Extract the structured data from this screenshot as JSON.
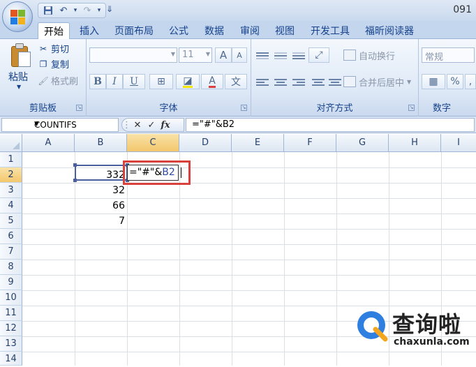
{
  "window": {
    "doc_title": "091"
  },
  "quick_access": {
    "save_icon": "save-icon",
    "undo_icon": "undo-icon",
    "redo_icon": "redo-icon",
    "more_symbol": "⇓"
  },
  "tabs": [
    {
      "label": "开始",
      "active": true
    },
    {
      "label": "插入"
    },
    {
      "label": "页面布局"
    },
    {
      "label": "公式"
    },
    {
      "label": "数据"
    },
    {
      "label": "审阅"
    },
    {
      "label": "视图"
    },
    {
      "label": "开发工具"
    },
    {
      "label": "福昕阅读器"
    }
  ],
  "ribbon": {
    "clipboard": {
      "label": "剪贴板",
      "paste": "粘贴",
      "cut": "剪切",
      "copy": "复制",
      "format_painter": "格式刷"
    },
    "font": {
      "label": "字体",
      "font_size": "11",
      "bold": "B",
      "italic": "I",
      "underline": "U",
      "grow": "A",
      "shrink": "A",
      "font_color": "A"
    },
    "alignment": {
      "label": "对齐方式",
      "wrap_text": "自动换行",
      "merge_center": "合并后居中"
    },
    "number": {
      "label": "数字",
      "format": "常规",
      "percent": "%",
      "comma": ","
    }
  },
  "formula_bar": {
    "name_box": "COUNTIFS",
    "cancel": "✕",
    "enter": "✓",
    "fx": "fx",
    "content": "=\"#\"&B2"
  },
  "grid": {
    "columns": [
      "A",
      "B",
      "C",
      "D",
      "E",
      "F",
      "G",
      "H",
      "I"
    ],
    "rows": [
      "1",
      "2",
      "3",
      "4",
      "5",
      "6",
      "7",
      "8",
      "9",
      "10",
      "11",
      "12",
      "13",
      "14"
    ],
    "cells": {
      "B2": "332",
      "B3": "32",
      "B4": "66",
      "B5": "7"
    },
    "editing_cell": "C2",
    "editing_text_prefix": "=\"#\"&",
    "editing_text_ref": "B2",
    "selected_ref_cell": "B2"
  },
  "watermark": {
    "cn": "查询啦",
    "en": "chaxunla.com"
  },
  "colors": {
    "accent": "#15428b",
    "selection_header": "#f3c76c",
    "highlight_box": "#d9423c",
    "reference_color": "#2d4aa8"
  }
}
